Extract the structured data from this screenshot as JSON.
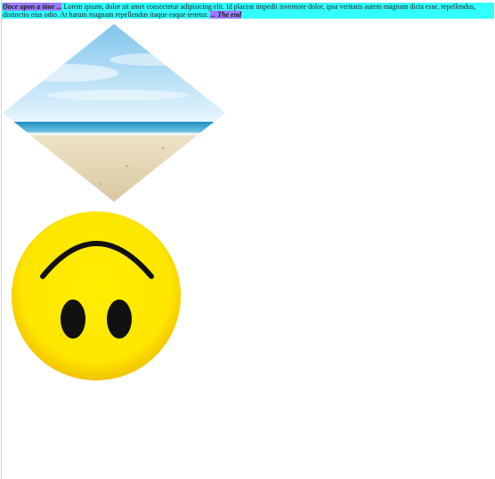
{
  "story": {
    "start": "Once upon a time ...",
    "body": "Lorem ipsum, dolor sit amet consectetur adipisicing elit. Id placeat impedit inventore dolor, ipsa veritatis autem magnam dicta esse, repellendus, distinctio eius odio. At harum magnam repellendus itaque eaque tenetur.",
    "end": "... The end"
  },
  "colors": {
    "story_bar": "#33ffff",
    "highlight": "#9a7cff",
    "smiley_face": "#ffee00"
  },
  "images": {
    "beach": "beach-scene-diamond",
    "smiley": "upside-down-smiley-icon"
  }
}
